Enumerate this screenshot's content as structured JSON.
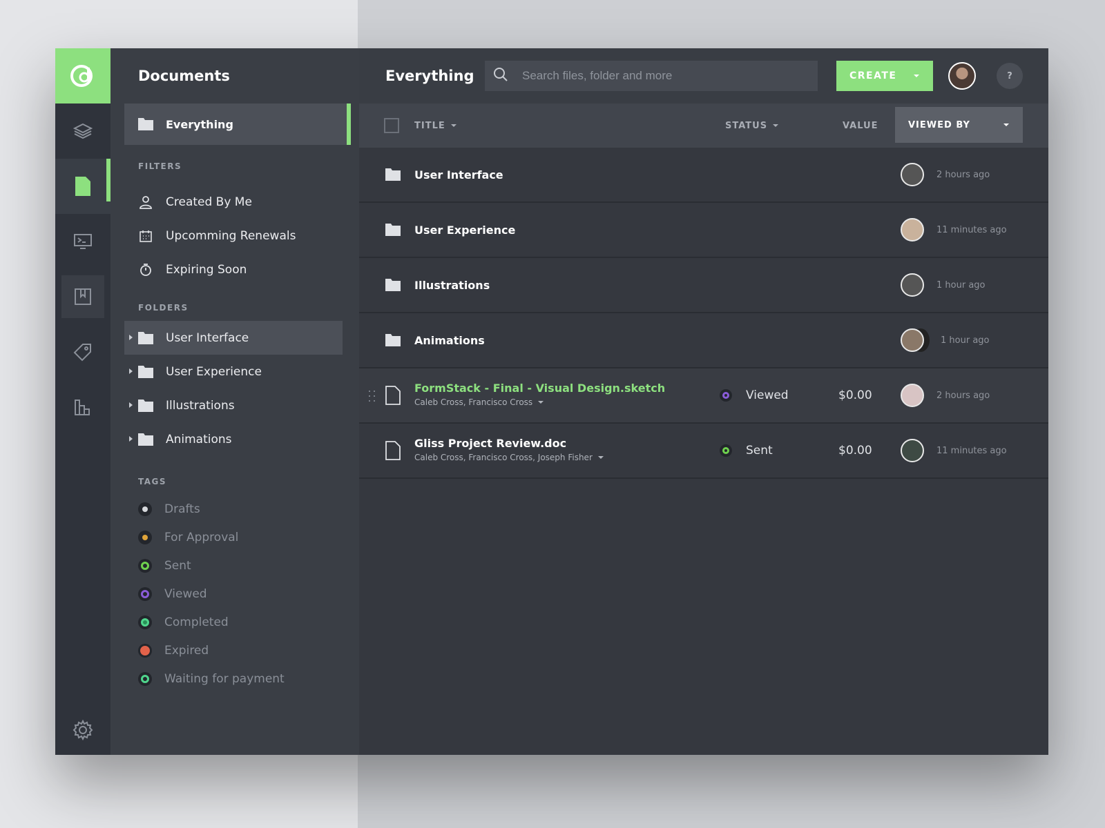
{
  "sidebar": {
    "title": "Documents",
    "everything_label": "Everything",
    "filters_label": "FILTERS",
    "filters": [
      {
        "label": "Created By Me",
        "icon": "user-icon"
      },
      {
        "label": "Upcomming Renewals",
        "icon": "calendar-icon"
      },
      {
        "label": "Expiring Soon",
        "icon": "stopwatch-icon"
      }
    ],
    "folders_label": "FOLDERS",
    "folders": [
      "User Interface",
      "User Experience",
      "Illustrations",
      "Animations"
    ],
    "tags_label": "TAGS",
    "tags": [
      {
        "label": "Drafts",
        "color": "#d6d8dc"
      },
      {
        "label": "For Approval",
        "color": "#e0a43a"
      },
      {
        "label": "Sent",
        "color": "#6fd14e"
      },
      {
        "label": "Viewed",
        "color": "#8a5cd8"
      },
      {
        "label": "Completed",
        "color": "#4fd58c"
      },
      {
        "label": "Expired",
        "color": "#e2624a"
      },
      {
        "label": "Waiting for payment",
        "color": "#4fd58c"
      }
    ]
  },
  "header": {
    "title": "Everything",
    "search_placeholder": "Search files, folder and more",
    "create_label": "CREATE",
    "help_label": "?"
  },
  "table": {
    "columns": {
      "title": "TITLE",
      "status": "STATUS",
      "value": "VALUE",
      "viewed_by": "VIEWED BY"
    },
    "folders": [
      {
        "name": "User Interface",
        "viewed": "2 hours ago"
      },
      {
        "name": "User Experience",
        "viewed": "11 minutes ago"
      },
      {
        "name": "Illustrations",
        "viewed": "1 hour ago"
      },
      {
        "name": "Animations",
        "viewed": "1 hour ago"
      }
    ],
    "files": [
      {
        "name": "FormStack - Final - Visual Design.sketch",
        "people": "Caleb Cross,  Francisco Cross",
        "status": "Viewed",
        "status_color": "#8a5cd8",
        "value": "$0.00",
        "viewed": "2 hours ago"
      },
      {
        "name": "Gliss Project Review.doc",
        "people": "Caleb Cross,  Francisco Cross, Joseph Fisher",
        "status": "Sent",
        "status_color": "#6fd14e",
        "value": "$0.00",
        "viewed": "11 minutes ago"
      }
    ]
  },
  "colors": {
    "accent": "#8de07f"
  }
}
